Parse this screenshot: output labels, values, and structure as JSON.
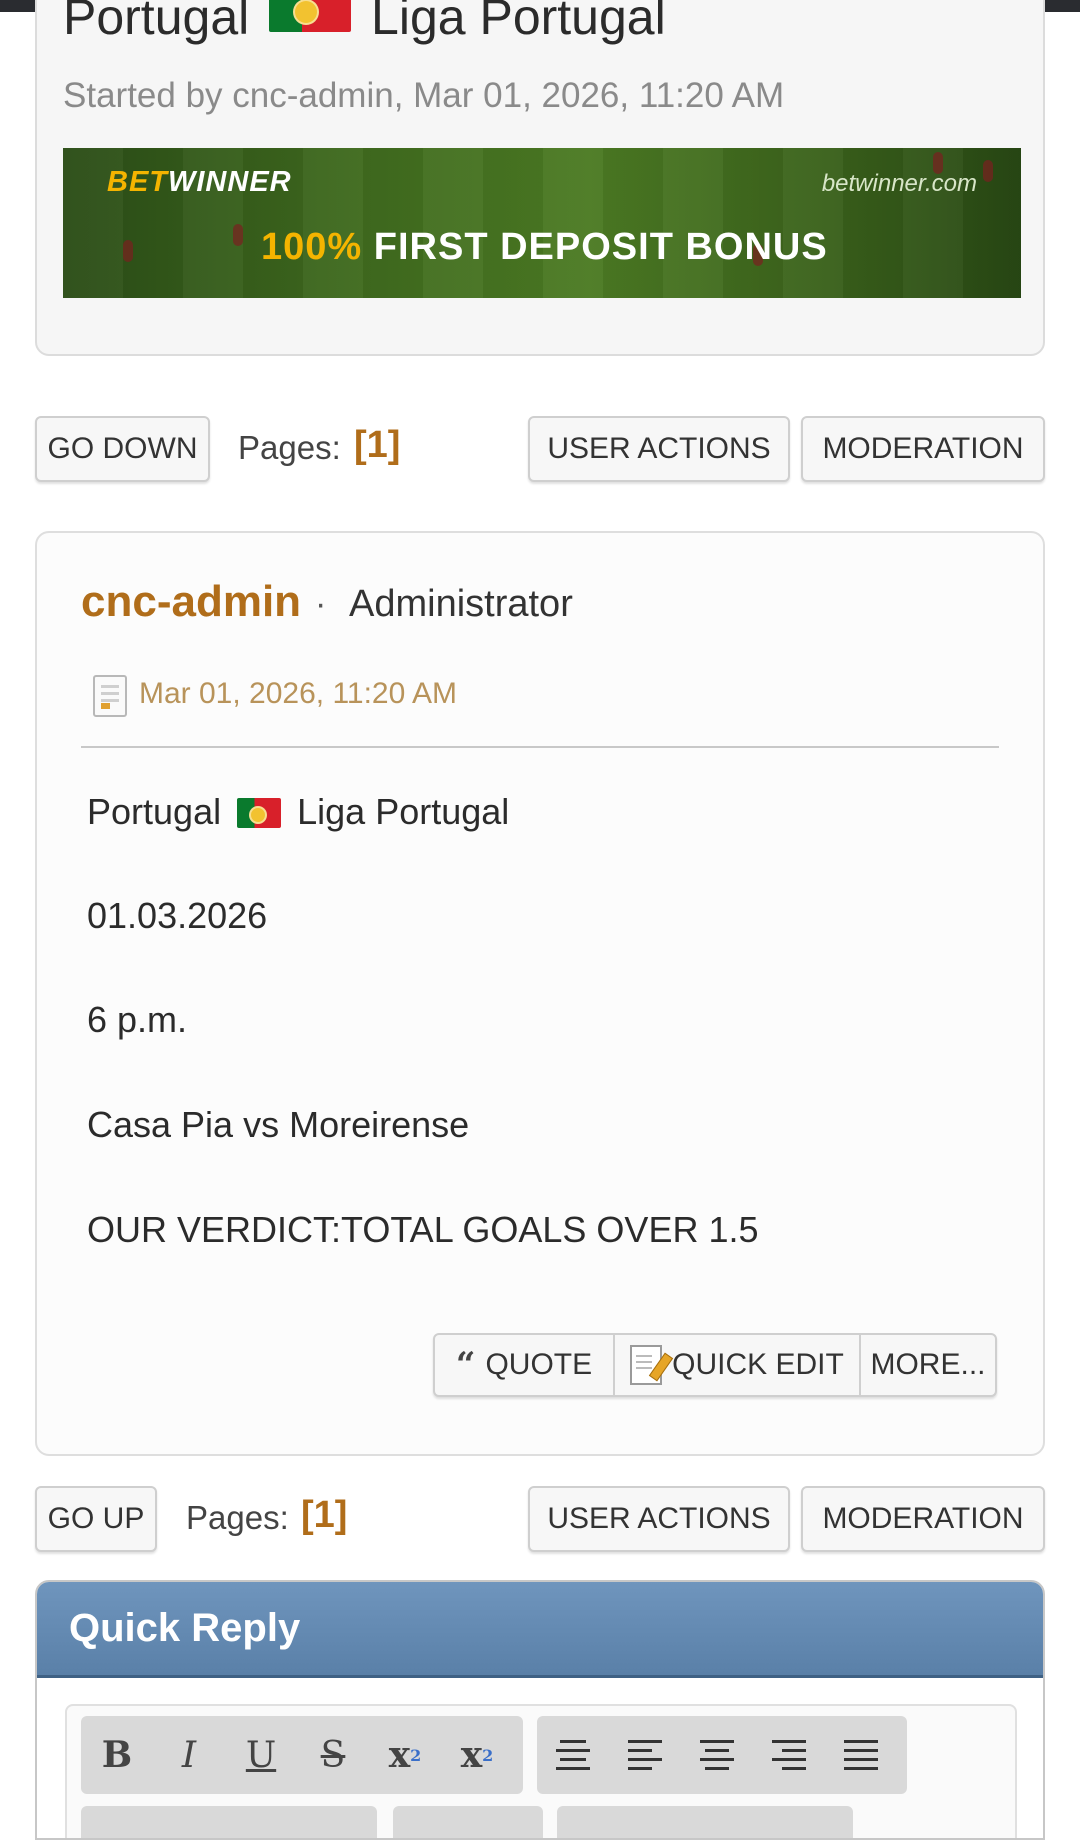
{
  "header": {
    "title_left": "Portugal",
    "title_right": "Liga Portugal",
    "started_by": "Started by cnc-admin, Mar 01, 2026, 11:20 AM"
  },
  "banner": {
    "brand_part1": "BET",
    "brand_part2": "WINNER",
    "site": "betwinner.com",
    "bonus_pct": "100%",
    "bonus_text": "FIRST DEPOSIT BONUS"
  },
  "nav_top": {
    "go_down": "GO DOWN",
    "pages_label": "Pages:",
    "pages_num": "[1]",
    "user_actions": "USER ACTIONS",
    "moderation": "MODERATION"
  },
  "post": {
    "author": "cnc-admin",
    "separator": "·",
    "role": "Administrator",
    "date": "Mar 01, 2026, 11:20 AM",
    "line1_left": "Portugal",
    "line1_right": "Liga Portugal",
    "line2": "01.03.2026",
    "line3": "6 p.m.",
    "line4": "Casa Pia vs Moreirense",
    "line5": "OUR VERDICT:TOTAL GOALS OVER 1.5",
    "actions": {
      "quote": "QUOTE",
      "quick_edit": "QUICK EDIT",
      "more": "MORE..."
    }
  },
  "nav_bottom": {
    "go_up": "GO UP",
    "pages_label": "Pages:",
    "pages_num": "[1]",
    "user_actions": "USER ACTIONS",
    "moderation": "MODERATION"
  },
  "quick_reply": {
    "title": "Quick Reply",
    "toolbar_format": [
      "B",
      "I",
      "U",
      "S",
      "x",
      "x"
    ],
    "toolbar_align": [
      "align-center-icon",
      "align-left-icon",
      "align-center-icon",
      "align-right-icon",
      "align-justify-icon"
    ]
  },
  "colors": {
    "accent_orange": "#b06d1a",
    "date_tan": "#b8935a",
    "quick_reply_blue": "#6f95bd",
    "bonus_yellow": "#f4b400"
  }
}
